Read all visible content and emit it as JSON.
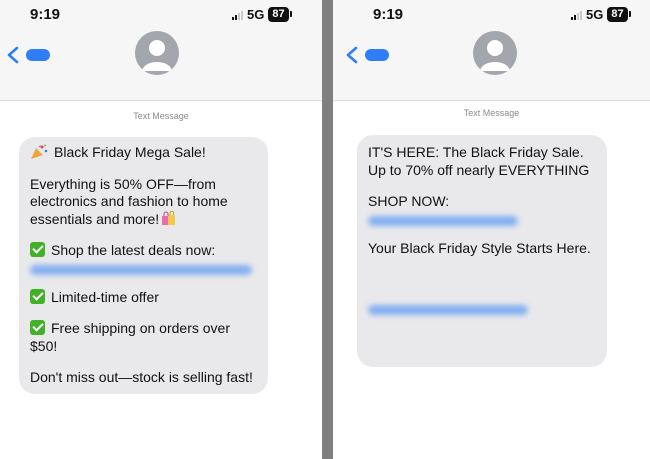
{
  "left": {
    "time": "9:19",
    "network": "5G",
    "battery": "87",
    "label": "Text Message",
    "message": {
      "title": "Black Friday Mega Sale!",
      "intro": "Everything is 50% OFF—from electronics and fashion to home essentials and more!",
      "item1": "Shop the latest deals now:",
      "item2": "Limited-time offer",
      "item3": "Free shipping on orders over $50!",
      "closing": "Don't miss out—stock is selling fast!"
    }
  },
  "right": {
    "time": "9:19",
    "network": "5G",
    "battery": "87",
    "label": "Text Message",
    "message": {
      "line1": "IT'S HERE: The Black Friday Sale. Up to 70% off nearly EVERYTHING",
      "shop": "SHOP NOW:",
      "tagline": "Your Black Friday Style Starts Here."
    }
  },
  "colors": {
    "link_blur": "#2f7ef6",
    "bubble": "#e9e9eb",
    "check": "#43b02a",
    "divider": "#7f7f7f"
  },
  "icons": [
    "back-chevron-icon",
    "avatar-icon",
    "signal-icon",
    "battery-icon",
    "party-popper-icon",
    "shopping-bags-icon",
    "check-mark-icon"
  ]
}
